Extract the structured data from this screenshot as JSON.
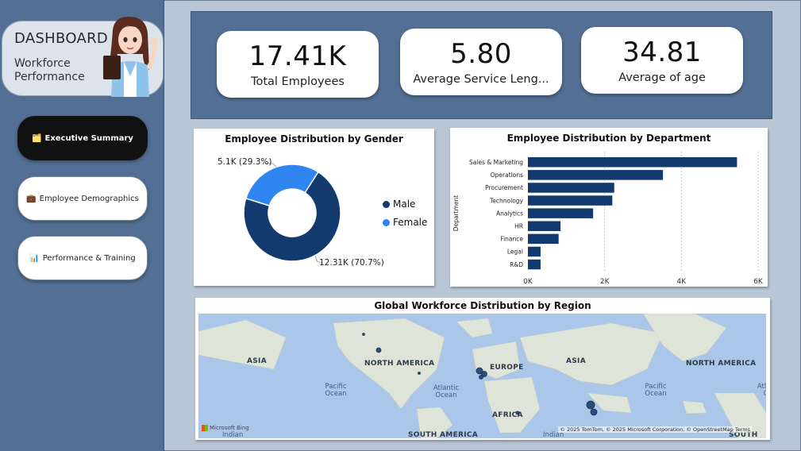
{
  "sidebar": {
    "title": "DASHBOARD",
    "subtitle": "Workforce Performance",
    "nav": [
      {
        "icon": "🗂️",
        "label": "Executive Summary"
      },
      {
        "icon": "💼",
        "label": "Employee Demographics"
      },
      {
        "icon": "📊",
        "label": "Performance & Training"
      }
    ]
  },
  "kpis": [
    {
      "value": "17.41K",
      "label": "Total Employees"
    },
    {
      "value": "5.80",
      "label": "Average Service Leng..."
    },
    {
      "value": "34.81",
      "label": "Average of age"
    }
  ],
  "gender_chart": {
    "title": "Employee Distribution by Gender",
    "label_female": "5.1K (29.3%)",
    "label_male": "12.31K (70.7%)",
    "legend": [
      {
        "name": "Male",
        "color": "#123a6e"
      },
      {
        "name": "Female",
        "color": "#2f86f0"
      }
    ]
  },
  "dept_chart": {
    "title": "Employee Distribution by Department",
    "ylabel": "Department"
  },
  "map": {
    "title": "Global Workforce Distribution by Region",
    "labels": [
      "ASIA",
      "NORTH AMERICA",
      "EUROPE",
      "ASIA",
      "NORTH AMERICA",
      "AFRICA",
      "SOUTH AMERICA",
      "SOUTH AM"
    ],
    "oceans": [
      "Pacific Ocean",
      "Atlantic Ocean",
      "Pacific Ocean",
      "Atlantic Oce",
      "Indian",
      "Indian"
    ],
    "attribution": "© 2025 TomTom, © 2025 Microsoft Corporation, © OpenStreetMap  Terms",
    "brand": "Microsoft Bing"
  },
  "chart_data": [
    {
      "type": "pie",
      "title": "Employee Distribution by Gender",
      "categories": [
        "Male",
        "Female"
      ],
      "values": [
        12310,
        5100
      ]
    },
    {
      "type": "bar",
      "title": "Employee Distribution by Department",
      "ylabel": "Department",
      "categories": [
        "Sales & Marketing",
        "Operations",
        "Procurement",
        "Technology",
        "Analytics",
        "HR",
        "Finance",
        "Legal",
        "R&D"
      ],
      "values": [
        5450,
        3520,
        2250,
        2200,
        1700,
        850,
        800,
        330,
        330
      ],
      "xlim": [
        0,
        6000
      ],
      "xticks": [
        "0K",
        "2K",
        "4K",
        "6K"
      ]
    }
  ]
}
